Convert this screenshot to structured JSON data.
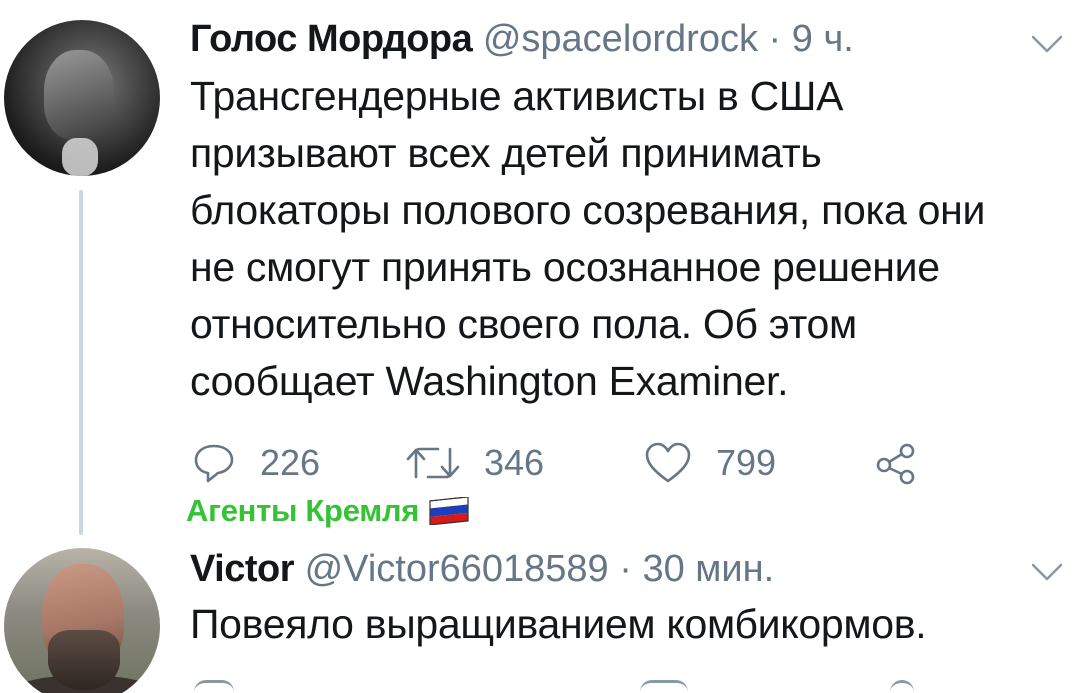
{
  "tweets": [
    {
      "author_name": "Голос Мордора",
      "handle": "@spacelordrock",
      "separator": "·",
      "time": "9 ч.",
      "text_lines": [
        "Трансгендерные активисты в США",
        "призывают всех детей принимать",
        "блокаторы полового созревания, пока они",
        "не смогут принять осознанное решение",
        "относительно своего пола. Об этом",
        "сообщает Washington Examiner."
      ],
      "replies": "226",
      "retweets": "346",
      "likes": "799"
    },
    {
      "author_name": "Victor",
      "handle": "@Victor66018589",
      "separator": "·",
      "time": "30 мин.",
      "text_lines": [
        "Повеяло выращиванием комбикормов."
      ]
    }
  ],
  "watermark": {
    "text": "Агенты Кремля",
    "flag_icon": "russian-flag-icon"
  },
  "colors": {
    "text": "#14171a",
    "meta": "#657786",
    "thread_line": "#ccd6dd",
    "watermark": "#35c335"
  },
  "icons": {
    "reply": "reply-icon",
    "retweet": "retweet-icon",
    "like": "heart-icon",
    "share": "share-icon",
    "menu": "chevron-down-icon"
  }
}
